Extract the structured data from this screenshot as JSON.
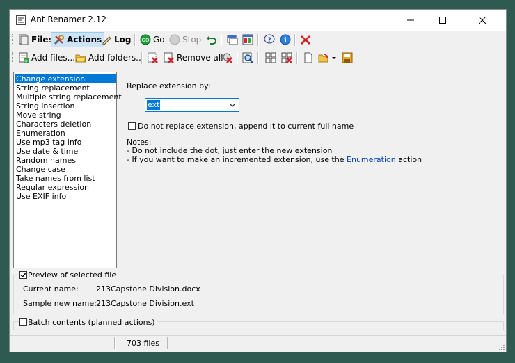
{
  "window": {
    "title": "Ant Renamer 2.12"
  },
  "toolbar1": {
    "files": "Files",
    "actions": "Actions",
    "log": "Log",
    "go": "Go",
    "stop": "Stop"
  },
  "toolbar2": {
    "add_files": "Add files...",
    "add_folders": "Add folders...",
    "remove_all": "Remove all"
  },
  "actions_list": [
    "Change extension",
    "String replacement",
    "Multiple string replacement",
    "String insertion",
    "Move string",
    "Characters deletion",
    "Enumeration",
    "Use mp3 tag info",
    "Use date & time",
    "Random names",
    "Change case",
    "Take names from list",
    "Regular expression",
    "Use EXIF info"
  ],
  "selected_action": "Change extension",
  "form": {
    "replace_label": "Replace extension by:",
    "extension_value": "ext",
    "append_checkbox_label": "Do not replace extension, append it to current full name",
    "append_checked": false,
    "notes_title": "Notes:",
    "note1": "- Do not include the dot, just enter the new extension",
    "note2_prefix": "- If you want to make an incremented extension, use the",
    "note2_link": "Enumeration",
    "note2_suffix": "action"
  },
  "preview": {
    "checkbox_label": "Preview of selected file",
    "checked": true,
    "current_label": "Current name:",
    "current_value": "213Capstone Division.docx",
    "sample_label": "Sample new name:",
    "sample_value": "213Capstone Division.ext"
  },
  "batch": {
    "checkbox_label": "Batch contents (planned actions)",
    "checked": false
  },
  "status": {
    "file_count": "703 files"
  },
  "colors": {
    "selection": "#0078d7",
    "link": "#0645ad",
    "desktop": "#2f5a52"
  }
}
